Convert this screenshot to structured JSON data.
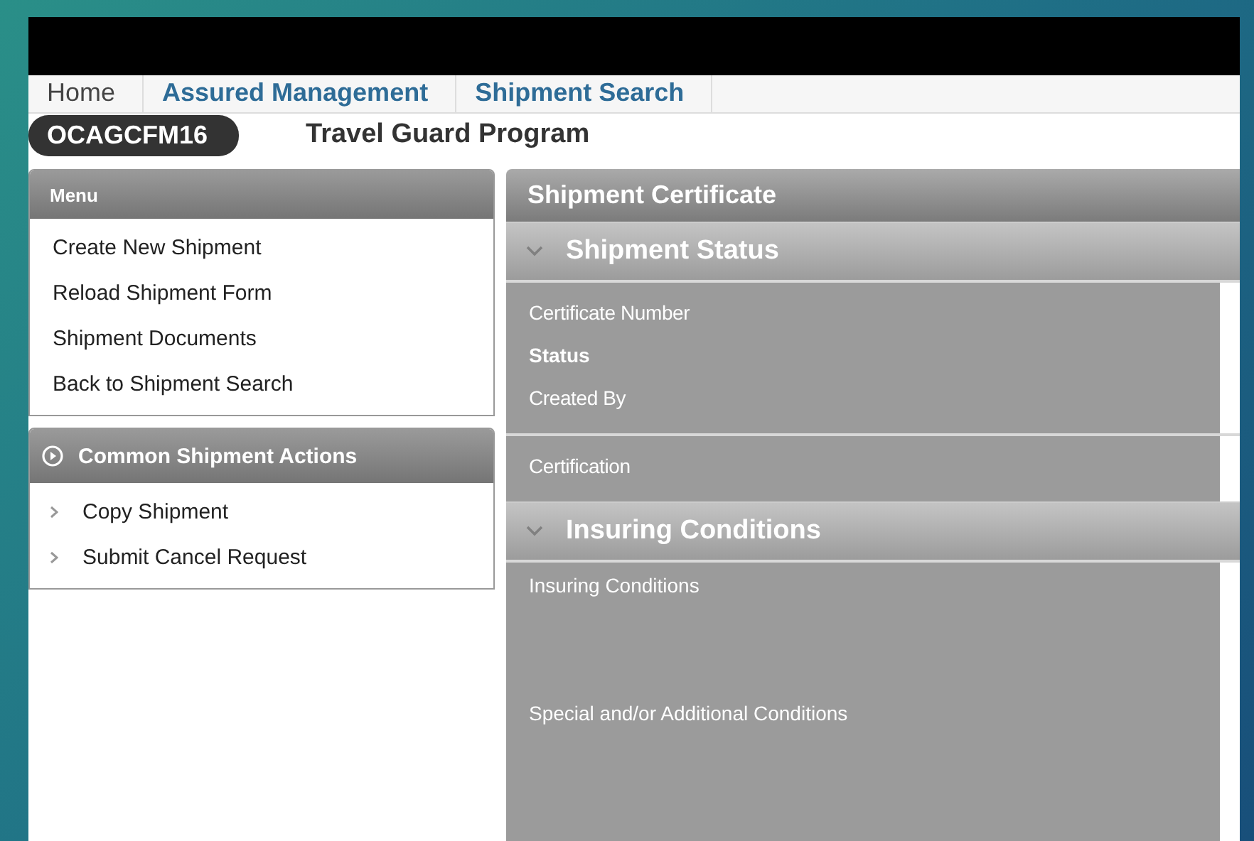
{
  "nav_tabs": [
    {
      "label": "Home",
      "selected": true
    },
    {
      "label": "Assured Management",
      "selected": false
    },
    {
      "label": "Shipment Search",
      "selected": false
    }
  ],
  "program": {
    "code": "OCAGCFM16",
    "name": "Travel Guard Program"
  },
  "menu": {
    "title": "Menu",
    "items": [
      "Create New Shipment",
      "Reload Shipment Form",
      "Shipment Documents",
      "Back to Shipment Search"
    ]
  },
  "actions": {
    "title": "Common Shipment Actions",
    "items": [
      "Copy Shipment",
      "Submit Cancel Request"
    ]
  },
  "certificate": {
    "title": "Shipment Certificate",
    "sections": [
      {
        "title": "Shipment Status",
        "expanded": true,
        "groups": [
          [
            {
              "label": "Certificate Number",
              "kind": "line"
            },
            {
              "label": "Status",
              "kind": "strong"
            },
            {
              "label": "Created By",
              "kind": "line"
            }
          ],
          [
            {
              "label": "Certification",
              "kind": "line"
            }
          ]
        ]
      },
      {
        "title": "Insuring Conditions",
        "expanded": true,
        "groups": [
          [
            {
              "label": "Insuring Conditions",
              "kind": "area"
            },
            {
              "label": "Special and/or Additional Conditions",
              "kind": "area"
            }
          ]
        ]
      }
    ]
  }
}
